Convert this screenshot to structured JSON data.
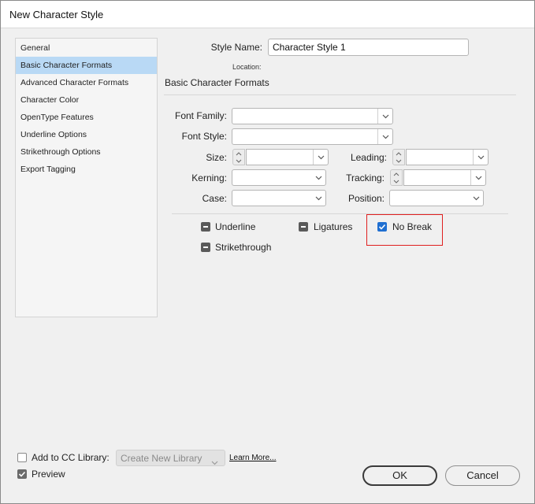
{
  "window": {
    "title": "New Character Style"
  },
  "sidebar": {
    "items": [
      {
        "label": "General"
      },
      {
        "label": "Basic Character Formats"
      },
      {
        "label": "Advanced Character Formats"
      },
      {
        "label": "Character Color"
      },
      {
        "label": "OpenType Features"
      },
      {
        "label": "Underline Options"
      },
      {
        "label": "Strikethrough Options"
      },
      {
        "label": "Export Tagging"
      }
    ],
    "selected_index": 1
  },
  "header": {
    "style_name_label": "Style Name:",
    "style_name_value": "Character Style 1",
    "location_label": "Location:",
    "section_title": "Basic Character Formats"
  },
  "fields": {
    "font_family_label": "Font Family:",
    "font_style_label": "Font Style:",
    "size_label": "Size:",
    "leading_label": "Leading:",
    "kerning_label": "Kerning:",
    "tracking_label": "Tracking:",
    "case_label": "Case:",
    "position_label": "Position:"
  },
  "checkboxes": {
    "underline": {
      "label": "Underline",
      "state": "mixed"
    },
    "ligatures": {
      "label": "Ligatures",
      "state": "mixed"
    },
    "no_break": {
      "label": "No Break",
      "state": "checked"
    },
    "strikethrough": {
      "label": "Strikethrough",
      "state": "mixed"
    }
  },
  "footer": {
    "add_cc_label": "Add to CC Library:",
    "add_cc_checked": false,
    "library_placeholder": "Create New Library",
    "learn_more": "Learn More...",
    "preview_label": "Preview",
    "preview_checked": true,
    "ok_label": "OK",
    "cancel_label": "Cancel"
  },
  "colors": {
    "selection": "#b9d9f5",
    "checkbox_checked": "#1f6fd1",
    "highlight_border": "#e02020"
  }
}
